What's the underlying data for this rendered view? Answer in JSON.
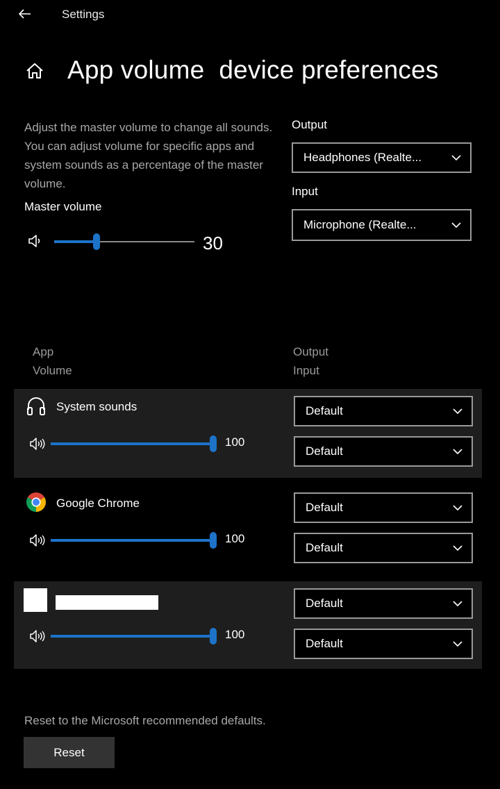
{
  "window": {
    "title": "Settings",
    "back_icon": "back-arrow-icon"
  },
  "page": {
    "title": "App volume  device preferences",
    "home_icon": "home-icon"
  },
  "description": "Adjust the master volume to change all sounds. You can adjust volume for specific apps and system sounds as a percentage of the master volume.",
  "master": {
    "label": "Master volume",
    "value": "30",
    "level": 0.3
  },
  "output": {
    "label": "Output",
    "selected": "Headphones (Realte..."
  },
  "input": {
    "label": "Input",
    "selected": "Microphone (Realte..."
  },
  "columns": {
    "app": "App",
    "volume": "Volume",
    "output": "Output",
    "input": "Input"
  },
  "apps": [
    {
      "name": "System sounds",
      "icon": "headphones-icon",
      "volume": "100",
      "level": 1.0,
      "output": "Default",
      "input": "Default"
    },
    {
      "name": "Google Chrome",
      "icon": "chrome-icon",
      "volume": "100",
      "level": 1.0,
      "output": "Default",
      "input": "Default"
    },
    {
      "name": "",
      "icon": "redacted-app-icon",
      "volume": "100",
      "level": 1.0,
      "output": "Default",
      "input": "Default"
    }
  ],
  "reset": {
    "note": "Reset to the Microsoft recommended defaults.",
    "button": "Reset"
  },
  "colors": {
    "accent": "#1d73c8",
    "background": "#000000",
    "row_alt": "#1e1e1e"
  }
}
